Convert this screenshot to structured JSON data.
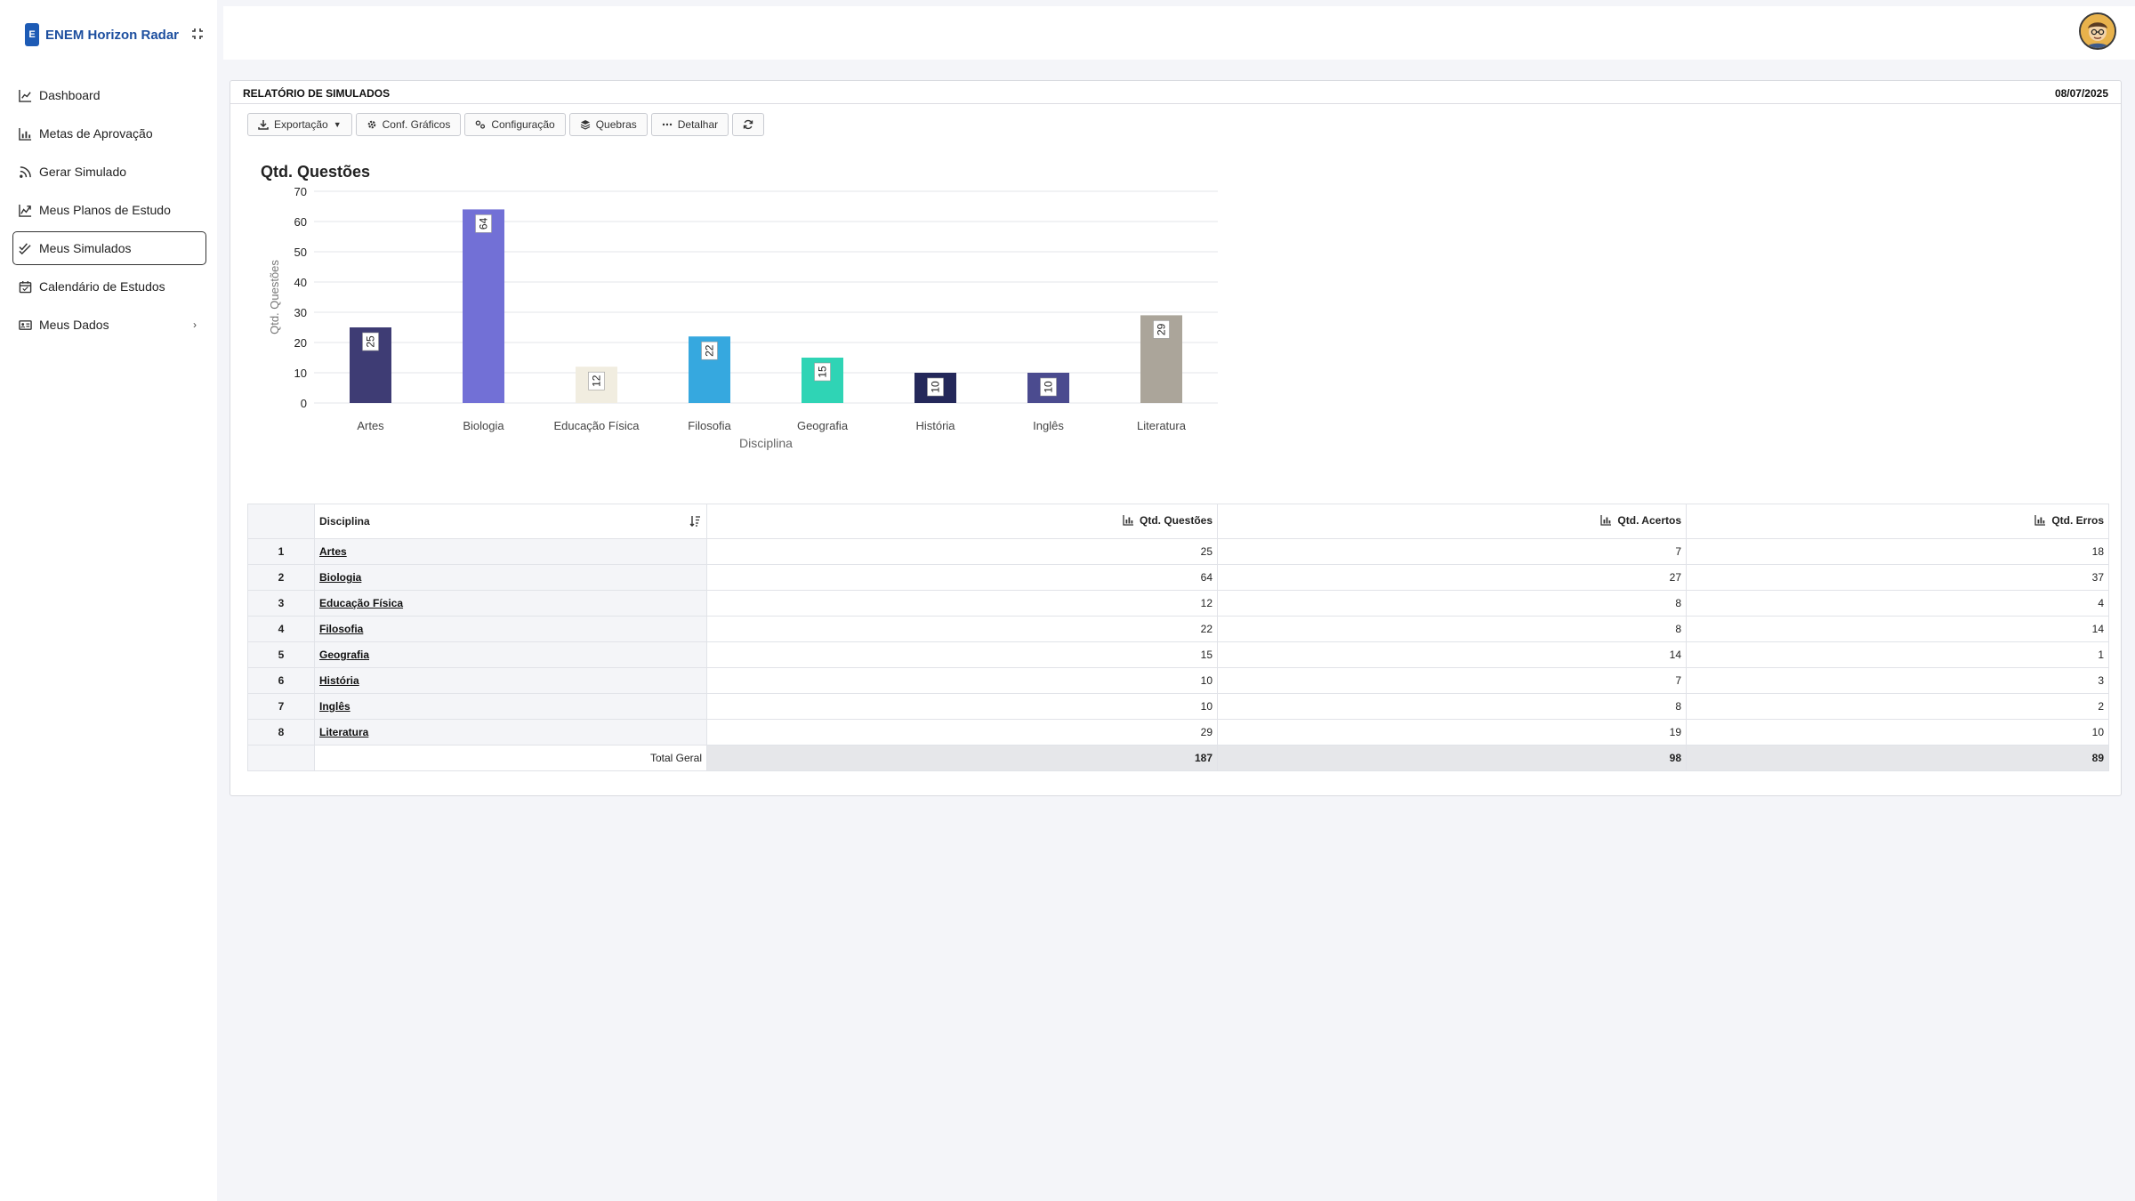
{
  "app": {
    "logo_letter": "E",
    "name": "ENEM Horizon Radar"
  },
  "sidebar": {
    "items": [
      {
        "label": "Dashboard",
        "icon": "line-chart-icon"
      },
      {
        "label": "Metas de Aprovação",
        "icon": "bar-chart-icon"
      },
      {
        "label": "Gerar Simulado",
        "icon": "rss-icon"
      },
      {
        "label": "Meus Planos de Estudo",
        "icon": "chart-area-icon"
      },
      {
        "label": "Meus Simulados",
        "icon": "check-double-icon",
        "active": true
      },
      {
        "label": "Calendário de Estudos",
        "icon": "calendar-icon"
      },
      {
        "label": "Meus Dados",
        "icon": "id-card-icon",
        "has_submenu": true
      }
    ]
  },
  "report": {
    "title": "RELATÓRIO DE SIMULADOS",
    "date": "08/07/2025"
  },
  "toolbar": {
    "export_label": "Exportação",
    "chart_config_label": "Conf. Gráficos",
    "config_label": "Configuração",
    "breaks_label": "Quebras",
    "detail_label": "Detalhar"
  },
  "chart_data": {
    "type": "bar",
    "title": "Qtd. Questões",
    "xlabel": "Disciplina",
    "ylabel": "Qtd. Questões",
    "ylim": [
      0,
      70
    ],
    "yticks": [
      0,
      10,
      20,
      30,
      40,
      50,
      60,
      70
    ],
    "grid": true,
    "categories": [
      "Artes",
      "Biologia",
      "Educação Física",
      "Filosofia",
      "Geografia",
      "História",
      "Inglês",
      "Literatura"
    ],
    "values": [
      25,
      64,
      12,
      22,
      15,
      10,
      10,
      29
    ],
    "colors": [
      "#3e3c74",
      "#7270d6",
      "#f1ede0",
      "#36a8df",
      "#2fd4b5",
      "#24285a",
      "#4b4b8f",
      "#aba59a"
    ]
  },
  "table": {
    "headers": {
      "discipline": "Disciplina",
      "questions": "Qtd. Questões",
      "correct": "Qtd. Acertos",
      "errors": "Qtd. Erros"
    },
    "rows": [
      {
        "idx": "1",
        "discipline": "Artes",
        "questions": "25",
        "correct": "7",
        "errors": "18"
      },
      {
        "idx": "2",
        "discipline": "Biologia",
        "questions": "64",
        "correct": "27",
        "errors": "37"
      },
      {
        "idx": "3",
        "discipline": "Educação Física",
        "questions": "12",
        "correct": "8",
        "errors": "4"
      },
      {
        "idx": "4",
        "discipline": "Filosofia",
        "questions": "22",
        "correct": "8",
        "errors": "14"
      },
      {
        "idx": "5",
        "discipline": "Geografia",
        "questions": "15",
        "correct": "14",
        "errors": "1"
      },
      {
        "idx": "6",
        "discipline": "História",
        "questions": "10",
        "correct": "7",
        "errors": "3"
      },
      {
        "idx": "7",
        "discipline": "Inglês",
        "questions": "10",
        "correct": "8",
        "errors": "2"
      },
      {
        "idx": "8",
        "discipline": "Literatura",
        "questions": "29",
        "correct": "19",
        "errors": "10"
      }
    ],
    "total": {
      "label": "Total Geral",
      "questions": "187",
      "correct": "98",
      "errors": "89"
    }
  }
}
